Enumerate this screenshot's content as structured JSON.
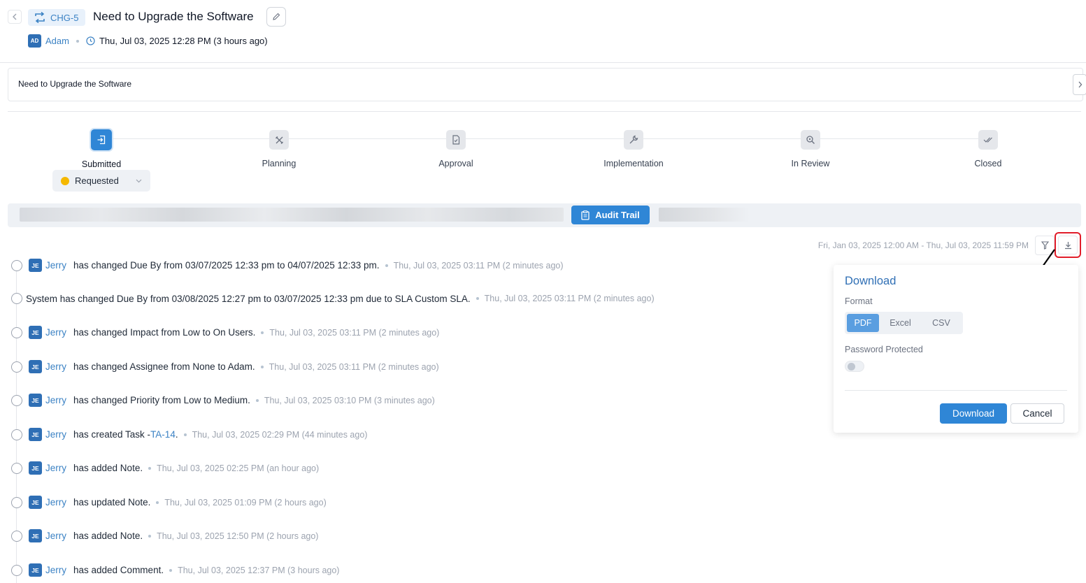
{
  "header": {
    "ticket_id": "CHG-5",
    "title": "Need to Upgrade the Software",
    "author_initials": "AD",
    "author": "Adam",
    "created_at": "Thu, Jul 03, 2025 12:28 PM (3 hours ago)"
  },
  "description": "Need to Upgrade the Software",
  "stepper": {
    "steps": [
      {
        "label": "Submitted",
        "icon": "submit-icon",
        "active": true
      },
      {
        "label": "Planning",
        "icon": "tools-icon",
        "active": false
      },
      {
        "label": "Approval",
        "icon": "document-check-icon",
        "active": false
      },
      {
        "label": "Implementation",
        "icon": "wrench-icon",
        "active": false
      },
      {
        "label": "In Review",
        "icon": "magnify-icon",
        "active": false
      },
      {
        "label": "Closed",
        "icon": "double-check-icon",
        "active": false
      }
    ],
    "status": "Requested",
    "status_color": "#f5b800"
  },
  "tabs": {
    "active_label": "Audit Trail"
  },
  "audit": {
    "date_range": "Fri, Jan 03, 2025 12:00 AM - Thu, Jul 03, 2025 11:59 PM",
    "entries": [
      {
        "initials": "JE",
        "user": "Jerry",
        "text": "has changed Due By from 03/07/2025 12:33 pm to 04/07/2025 12:33 pm.",
        "time": "Thu, Jul 03, 2025 03:11 PM (2 minutes ago)"
      },
      {
        "initials": "",
        "user": "",
        "text": "System has changed Due By from 03/08/2025 12:27 pm to 03/07/2025 12:33 pm due to SLA Custom SLA.",
        "time": "Thu, Jul 03, 2025 03:11 PM (2 minutes ago)"
      },
      {
        "initials": "JE",
        "user": "Jerry",
        "text": "has changed Impact from Low to On Users.",
        "time": "Thu, Jul 03, 2025 03:11 PM (2 minutes ago)"
      },
      {
        "initials": "JE",
        "user": "Jerry",
        "text": "has changed Assignee from None to Adam.",
        "time": "Thu, Jul 03, 2025 03:11 PM (2 minutes ago)"
      },
      {
        "initials": "JE",
        "user": "Jerry",
        "text": "has changed Priority from Low to Medium.",
        "time": "Thu, Jul 03, 2025 03:10 PM (3 minutes ago)"
      },
      {
        "initials": "JE",
        "user": "Jerry",
        "text": "has created Task - ",
        "link": "TA-14",
        "text_after": ".",
        "time": "Thu, Jul 03, 2025 02:29 PM (44 minutes ago)"
      },
      {
        "initials": "JE",
        "user": "Jerry",
        "text": "has added Note.",
        "time": "Thu, Jul 03, 2025 02:25 PM (an hour ago)"
      },
      {
        "initials": "JE",
        "user": "Jerry",
        "text": "has updated Note.",
        "time": "Thu, Jul 03, 2025 01:09 PM (2 hours ago)"
      },
      {
        "initials": "JE",
        "user": "Jerry",
        "text": "has added Note.",
        "time": "Thu, Jul 03, 2025 12:50 PM (2 hours ago)"
      },
      {
        "initials": "JE",
        "user": "Jerry",
        "text": "has added Comment.",
        "time": "Thu, Jul 03, 2025 12:37 PM (3 hours ago)"
      }
    ]
  },
  "download_popover": {
    "title": "Download",
    "format_label": "Format",
    "formats": [
      "PDF",
      "Excel",
      "CSV"
    ],
    "selected_format": "PDF",
    "password_label": "Password Protected",
    "password_enabled": false,
    "download_label": "Download",
    "cancel_label": "Cancel"
  },
  "colors": {
    "accent": "#2f86d6",
    "link": "#3b82c4",
    "highlight_border": "#e11d2a"
  }
}
